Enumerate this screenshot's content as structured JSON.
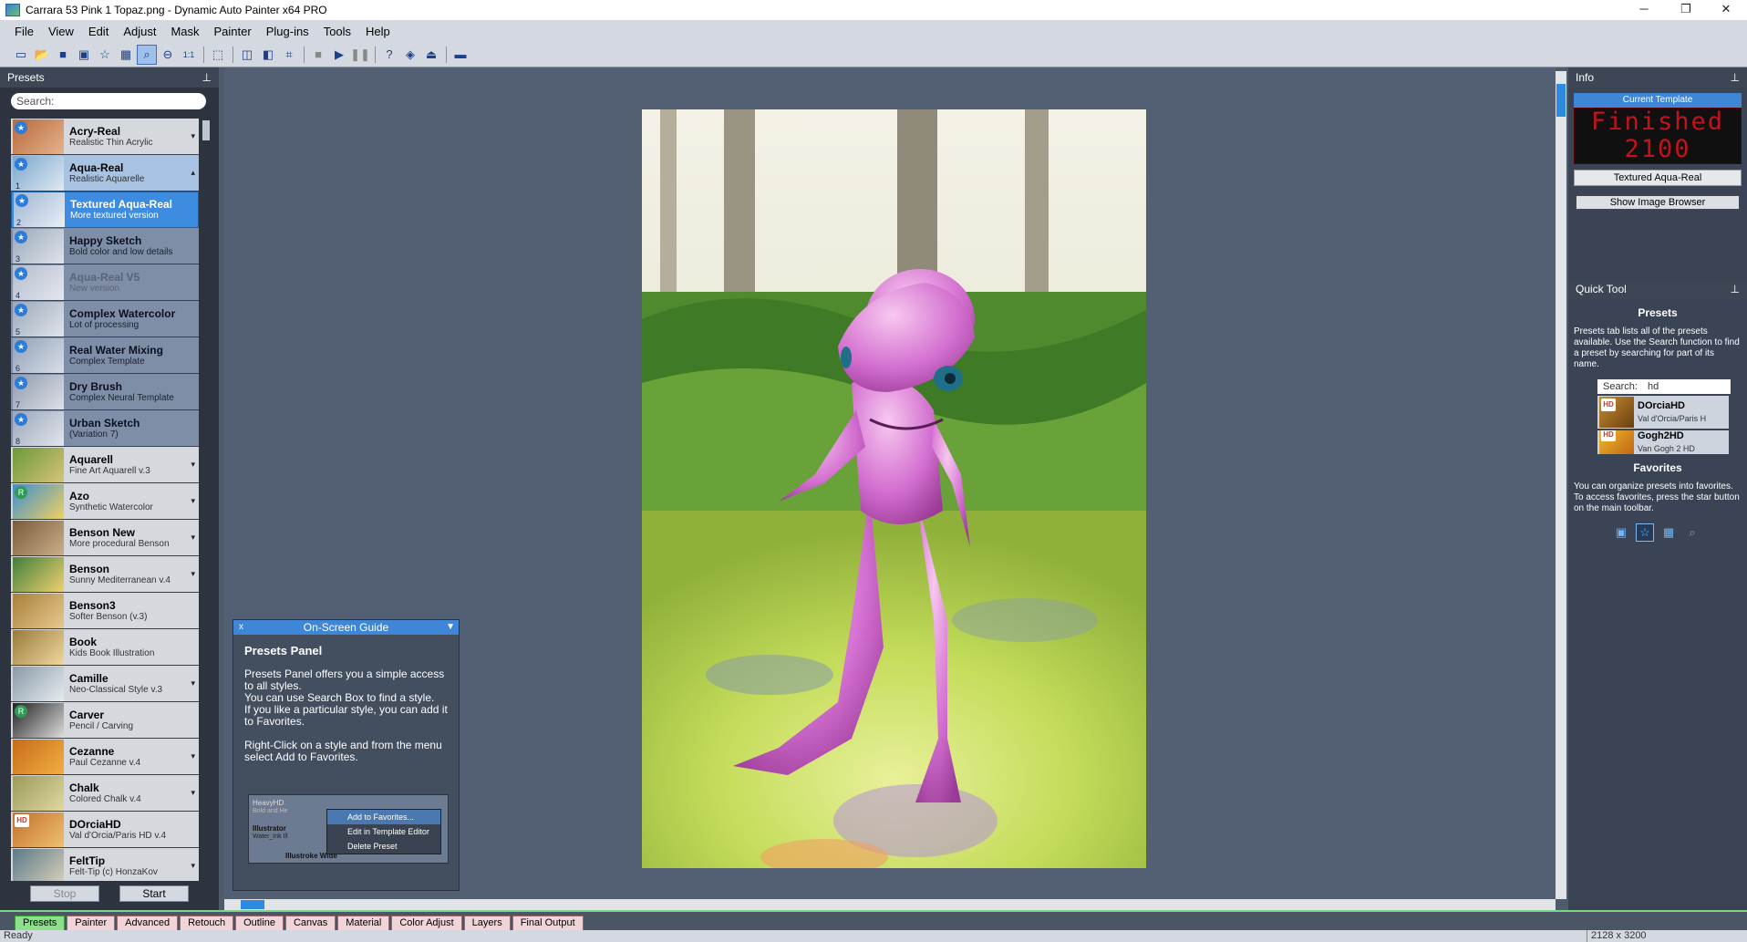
{
  "window": {
    "title": "Carrara 53 Pink 1 Topaz.png - Dynamic Auto Painter x64 PRO",
    "minimize": "─",
    "restore": "❐",
    "close": "✕"
  },
  "menu": [
    "File",
    "View",
    "Edit",
    "Adjust",
    "Mask",
    "Painter",
    "Plug-ins",
    "Tools",
    "Help"
  ],
  "toolbar_icons": [
    "new-icon",
    "open-icon",
    "save-icon",
    "save-as-icon",
    "favorites-star-icon",
    "image-browser-icon",
    "zoom-fit-icon",
    "zoom-out-icon",
    "actual-size-icon",
    "crop-frame-icon",
    "compare-icon",
    "split-view-icon",
    "crop-icon",
    "stop-icon",
    "play-icon",
    "pause-icon",
    "help-icon",
    "layers-icon",
    "upload-icon",
    "canvas-color-icon"
  ],
  "toolbar_labels": {
    "actual_size": "1:1"
  },
  "presets_panel": {
    "title": "Presets",
    "search_placeholder": "Search:",
    "items": [
      {
        "name": "Acry-Real",
        "desc": "Realistic Thin Acrylic",
        "badge": "★",
        "state": "normal",
        "arrow": "▾"
      },
      {
        "name": "Aqua-Real",
        "desc": "Realistic Aquarelle",
        "badge": "★",
        "num": "1",
        "state": "open",
        "arrow": "▴"
      },
      {
        "name": "Textured Aqua-Real",
        "desc": "More textured version",
        "badge": "★",
        "num": "2",
        "state": "selected"
      },
      {
        "name": "Happy Sketch",
        "desc": "Bold color and low details",
        "badge": "★",
        "num": "3",
        "state": "variant"
      },
      {
        "name": "Aqua-Real V5",
        "desc": "New version",
        "badge": "★",
        "num": "4",
        "state": "faded"
      },
      {
        "name": "Complex Watercolor",
        "desc": "Lot of processing",
        "badge": "★",
        "num": "5",
        "state": "variant"
      },
      {
        "name": "Real Water Mixing",
        "desc": "Complex Template",
        "badge": "★",
        "num": "6",
        "state": "variant"
      },
      {
        "name": "Dry Brush",
        "desc": "Complex Neural Template",
        "badge": "★",
        "num": "7",
        "state": "variant"
      },
      {
        "name": "Urban Sketch",
        "desc": "(Variation 7)",
        "badge": "★",
        "num": "8",
        "state": "variant"
      },
      {
        "name": "Aquarell",
        "desc": "Fine Art Aquarell v.3",
        "state": "normal",
        "arrow": "▾"
      },
      {
        "name": "Azo",
        "desc": "Synthetic Watercolor",
        "badge": "R",
        "state": "normal",
        "arrow": "▾"
      },
      {
        "name": "Benson New",
        "desc": "More procedural Benson",
        "state": "normal",
        "arrow": "▾"
      },
      {
        "name": "Benson",
        "desc": "Sunny Mediterranean v.4",
        "state": "normal",
        "arrow": "▾"
      },
      {
        "name": "Benson3",
        "desc": "Softer Benson (v.3)",
        "state": "normal"
      },
      {
        "name": "Book",
        "desc": "Kids Book Illustration",
        "state": "normal"
      },
      {
        "name": "Camille",
        "desc": "Neo-Classical Style v.3",
        "state": "normal",
        "arrow": "▾"
      },
      {
        "name": "Carver",
        "desc": "Pencil / Carving",
        "badge": "R",
        "state": "normal"
      },
      {
        "name": "Cezanne",
        "desc": "Paul Cezanne v.4",
        "state": "normal",
        "arrow": "▾"
      },
      {
        "name": "Chalk",
        "desc": "Colored Chalk v.4",
        "state": "normal",
        "arrow": "▾"
      },
      {
        "name": "DOrciaHD",
        "desc": "Val d'Orcia/Paris HD v.4",
        "badge": "HD",
        "state": "normal"
      },
      {
        "name": "FeltTip",
        "desc": "Felt-Tip (c) HonzaKov",
        "state": "normal",
        "arrow": "▾"
      }
    ],
    "stop_label": "Stop",
    "start_label": "Start"
  },
  "guide": {
    "title": "On-Screen Guide",
    "close": "x",
    "heading": "Presets Panel",
    "body": "Presets Panel offers you a simple access to all styles.\nYou can use Search Box to find a style.\nIf you like a particular style, you can add it to Favorites.\n\nRight-Click on a style and from the menu select Add to Favorites.",
    "shot_items": [
      "HeavyHD",
      "Illustrator",
      "Illustroke Wide"
    ],
    "shot_desc": [
      "Bold and He",
      "Water_Ink Ill"
    ],
    "context_menu": [
      "Add to Favorites...",
      "Edit in Template Editor",
      "Delete Preset"
    ]
  },
  "info_panel": {
    "title": "Info",
    "current_template_label": "Current Template",
    "led_line1": "Finished",
    "led_line2": "2100",
    "template_name": "Textured Aqua-Real",
    "show_browser": "Show Image Browser"
  },
  "quick_tool": {
    "title": "Quick Tool",
    "presets_heading": "Presets",
    "presets_text": "Presets tab lists all of the presets available. Use the Search function to find a preset by searching for part of its name.",
    "search_label": "Search:",
    "search_value": "hd",
    "results": [
      {
        "name": "DOrciaHD",
        "desc": "Val d'Orcia/Paris H"
      },
      {
        "name": "Gogh2HD",
        "desc": "Van Gogh 2 HD"
      }
    ],
    "favorites_heading": "Favorites",
    "favorites_text": "You can organize presets into favorites. To access favorites, press the star button on the main toolbar."
  },
  "bottom_tabs": [
    "Presets",
    "Painter",
    "Advanced",
    "Retouch",
    "Outline",
    "Canvas",
    "Material",
    "Color Adjust",
    "Layers",
    "Final Output"
  ],
  "status": {
    "text": "Ready",
    "dimensions": "2128 x 3200"
  },
  "colors": {
    "accent": "#3e8ce0",
    "panel_bg": "#2d3440",
    "canvas_bg": "#535f72",
    "led_red": "#c4131a",
    "active_tab": "#8ce08a"
  }
}
